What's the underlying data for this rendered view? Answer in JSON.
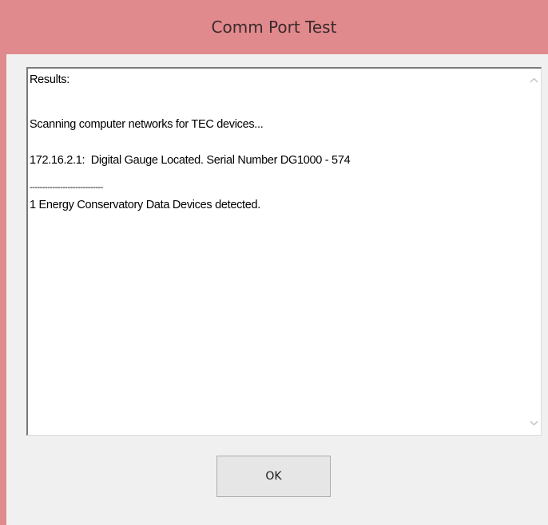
{
  "window": {
    "title": "Comm Port Test"
  },
  "results": {
    "lines": [
      "Results:",
      "Scanning computer networks for TEC devices...",
      "172.16.2.1:  Digital Gauge Located. Serial Number DG1000 - 574",
      "-----------------------------",
      "1 Energy Conservatory Data Devices detected."
    ]
  },
  "buttons": {
    "ok_label": "OK"
  },
  "icons": {
    "scroll_up": "chevron-up-icon",
    "scroll_down": "chevron-down-icon"
  },
  "colors": {
    "titlebar": "#e18a8e",
    "title_text": "#3b2a2b",
    "client_bg": "#f0f0f0",
    "textbox_bg": "#ffffff"
  }
}
